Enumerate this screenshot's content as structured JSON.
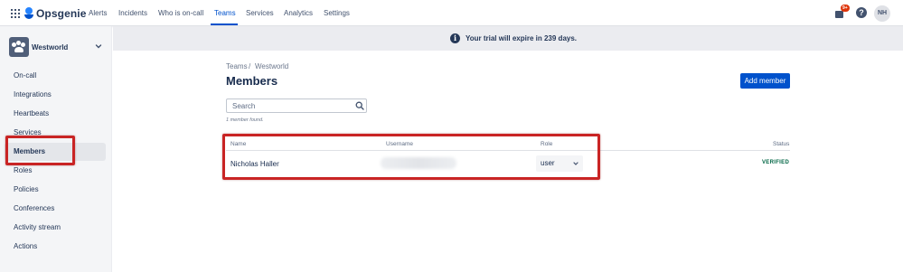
{
  "topnav": {
    "logo_text": "Opsgenie",
    "items": [
      {
        "label": "Alerts"
      },
      {
        "label": "Incidents"
      },
      {
        "label": "Who is on-call"
      },
      {
        "label": "Teams"
      },
      {
        "label": "Services"
      },
      {
        "label": "Analytics"
      },
      {
        "label": "Settings"
      }
    ],
    "active_item": "Teams",
    "notification_badge": "9+",
    "help_glyph": "?",
    "avatar_initials": "NH",
    "icons": [
      "app-switcher-icon",
      "opsgenie-logo-icon",
      "notification-icon",
      "help-icon"
    ]
  },
  "sidebar": {
    "team_name": "Westworld",
    "items": [
      {
        "label": "On-call"
      },
      {
        "label": "Integrations"
      },
      {
        "label": "Heartbeats"
      },
      {
        "label": "Services"
      },
      {
        "label": "Members"
      },
      {
        "label": "Roles"
      },
      {
        "label": "Policies"
      },
      {
        "label": "Conferences"
      },
      {
        "label": "Activity stream"
      },
      {
        "label": "Actions"
      }
    ],
    "selected_item": "Members"
  },
  "banner": {
    "icon_glyph": "i",
    "text": "Your trial will expire in 239 days."
  },
  "main": {
    "breadcrumb": [
      "Teams",
      "Westworld"
    ],
    "breadcrumb_separator": "/",
    "title": "Members",
    "add_button_label": "Add member",
    "search_placeholder": "Search",
    "found_text": "1 member found.",
    "table": {
      "headers": {
        "name": "Name",
        "username": "Username",
        "role": "Role",
        "status": "Status"
      },
      "rows": [
        {
          "name": "Nicholas Haller",
          "username": "",
          "role": "user",
          "status": "VERIFIED"
        }
      ]
    }
  },
  "colors": {
    "accent": "#0052cc",
    "highlight": "#c92424",
    "verified": "#006644"
  }
}
